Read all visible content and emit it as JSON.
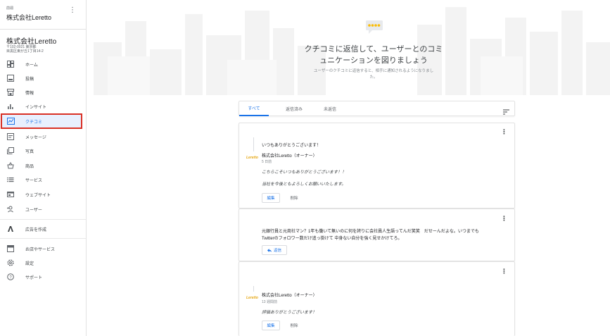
{
  "sidebar": {
    "header_small": "前週",
    "header_title": "株式会社Leretto",
    "menu_icon": "more-vert-icon",
    "business_name": "株式会社Leretto",
    "business_address_1": "〒102-0021 東京都",
    "business_address_2": "目黒区東が丘1丁目14-2",
    "items": [
      {
        "label": "ホーム",
        "icon": "dashboard-icon"
      },
      {
        "label": "投稿",
        "icon": "post-icon"
      },
      {
        "label": "情報",
        "icon": "storefront-icon"
      },
      {
        "label": "インサイト",
        "icon": "insights-icon"
      },
      {
        "label": "クチコミ",
        "icon": "reviews-icon"
      },
      {
        "label": "メッセージ",
        "icon": "message-icon"
      },
      {
        "label": "写真",
        "icon": "photos-icon"
      },
      {
        "label": "商品",
        "icon": "products-icon"
      },
      {
        "label": "サービス",
        "icon": "services-icon"
      },
      {
        "label": "ウェブサイト",
        "icon": "website-icon"
      },
      {
        "label": "ユーザー",
        "icon": "add-user-icon"
      },
      {
        "label": "広告を作成",
        "icon": "ads-icon"
      },
      {
        "label": "お店やサービス",
        "icon": "business-icon"
      },
      {
        "label": "設定",
        "icon": "settings-icon"
      },
      {
        "label": "サポート",
        "icon": "help-icon"
      }
    ]
  },
  "hero": {
    "title": "クチコミに返信して、ユーザーとのコミュニケーションを図りましょう",
    "subtitle": "ユーザーのクチコミに返信すると、相手に通知されるようになりました。"
  },
  "tabs": {
    "all": "すべて",
    "replied": "返信済み",
    "unreplied": "未返信"
  },
  "reviews": [
    {
      "review_text": "いつもありがとうございます！",
      "owner_name": "株式会社Leretto（オーナー）",
      "reply_time": "5 日前",
      "reply_line_1": "こちらこそいつもありがとうございます！！",
      "reply_line_2": "当社を今後ともよろしくお願いいたします。",
      "edit_label": "編集",
      "delete_label": "削除",
      "logo_text": "Leretto"
    },
    {
      "review_line_1": "元銀行員と元商社マン？1年も働いて無いのに何を誇りに会社員人生語ってんだ笑笑　だせーんだよな。いつまでも",
      "review_line_2": "Twitterのフォロワー数だけ追っ掛けて 中身ない自分を強く見せかけてろ。",
      "reply_label": "返信"
    },
    {
      "owner_name": "株式会社Leretto（オーナー）",
      "reply_time": "13 週間前",
      "reply_line_1": "評価ありがとうございます！",
      "edit_label": "編集",
      "delete_label": "削除",
      "logo_text": "Leretto"
    }
  ],
  "colors": {
    "accent": "#1a73e8",
    "highlight_border": "#d93025",
    "active_bg": "#e8f0fe"
  }
}
